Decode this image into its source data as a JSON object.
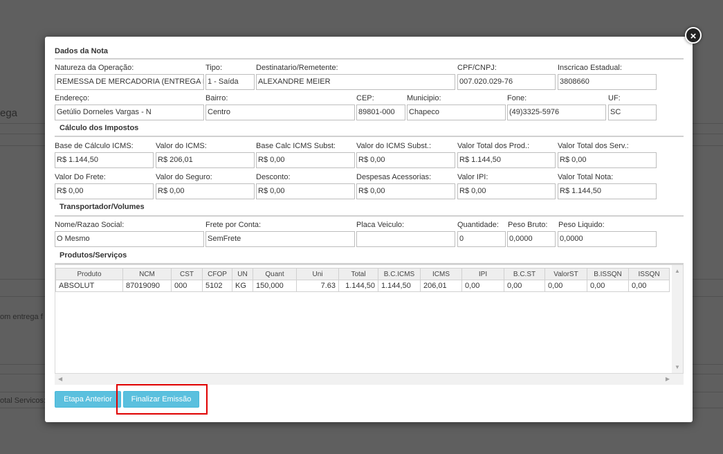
{
  "background": {
    "title_fragment": "ega",
    "row_text_fragment": "om entrega f",
    "total_services_fragment": "otal Servicos:"
  },
  "modal": {
    "close_glyph": "×",
    "sections": {
      "dados_nota": "Dados da Nota",
      "impostos": "Cálculo dos Impostos",
      "transportador": "Transportador/Volumes",
      "produtos": "Produtos/Serviços"
    },
    "fields": {
      "natureza": {
        "label": "Natureza da Operação:",
        "value": "REMESSA DE MERCADORIA (ENTREGA FUTURA)"
      },
      "tipo": {
        "label": "Tipo:",
        "value": "1 - Saída"
      },
      "destinatario": {
        "label": "Destinatario/Remetente:",
        "value": "ALEXANDRE MEIER"
      },
      "cpf": {
        "label": "CPF/CNPJ:",
        "value": "007.020.029-76"
      },
      "ie": {
        "label": "Inscricao Estadual:",
        "value": "3808660"
      },
      "endereco": {
        "label": "Endereço:",
        "value": "Getúlio Dorneles Vargas - N"
      },
      "bairro": {
        "label": "Bairro:",
        "value": "Centro"
      },
      "cep": {
        "label": "CEP:",
        "value": "89801-000"
      },
      "municipio": {
        "label": "Municipio:",
        "value": "Chapeco"
      },
      "fone": {
        "label": "Fone:",
        "value": "(49)3325-5976"
      },
      "uf": {
        "label": "UF:",
        "value": "SC"
      },
      "base_icms": {
        "label": "Base de Cálculo ICMS:",
        "value": "R$ 1.144,50"
      },
      "valor_icms": {
        "label": "Valor do ICMS:",
        "value": "R$ 206,01"
      },
      "base_icms_st": {
        "label": "Base Calc ICMS Subst:",
        "value": "R$ 0,00"
      },
      "valor_icms_st": {
        "label": "Valor do ICMS Subst.:",
        "value": "R$ 0,00"
      },
      "total_prod": {
        "label": "Valor Total dos Prod.:",
        "value": "R$ 1.144,50"
      },
      "total_serv": {
        "label": "Valor Total dos Serv.:",
        "value": "R$ 0,00"
      },
      "frete": {
        "label": "Valor Do Frete:",
        "value": "R$ 0,00"
      },
      "seguro": {
        "label": "Valor do Seguro:",
        "value": "R$ 0,00"
      },
      "desconto": {
        "label": "Desconto:",
        "value": "R$ 0,00"
      },
      "despesas": {
        "label": "Despesas Acessorias:",
        "value": "R$ 0,00"
      },
      "ipi": {
        "label": "Valor IPI:",
        "value": "R$ 0,00"
      },
      "total_nota": {
        "label": "Valor Total Nota:",
        "value": "R$ 1.144,50"
      },
      "razao": {
        "label": "Nome/Razao Social:",
        "value": "O Mesmo"
      },
      "frete_conta": {
        "label": "Frete por Conta:",
        "value": "SemFrete"
      },
      "placa": {
        "label": "Placa Veiculo:",
        "value": ""
      },
      "quantidade": {
        "label": "Quantidade:",
        "value": "0"
      },
      "peso_bruto": {
        "label": "Peso Bruto:",
        "value": "0,0000"
      },
      "peso_liquido": {
        "label": "Peso Liquido:",
        "value": "0,0000"
      }
    },
    "grid": {
      "columns": [
        "Produto",
        "NCM",
        "CST",
        "CFOP",
        "UN",
        "Quant",
        "Uni",
        "Total",
        "B.C.ICMS",
        "ICMS",
        "IPI",
        "B.C.ST",
        "ValorST",
        "B.ISSQN",
        "ISSQN"
      ],
      "rows": [
        [
          "ABSOLUT",
          "87019090",
          "000",
          "5102",
          "KG",
          "150,000",
          "7.63",
          "1.144,50",
          "1.144,50",
          "206,01",
          "0,00",
          "0,00",
          "0,00",
          "0,00",
          "0,00"
        ]
      ]
    },
    "buttons": {
      "previous": "Etapa Anterior",
      "finish": "Finalizar Emissão"
    }
  }
}
